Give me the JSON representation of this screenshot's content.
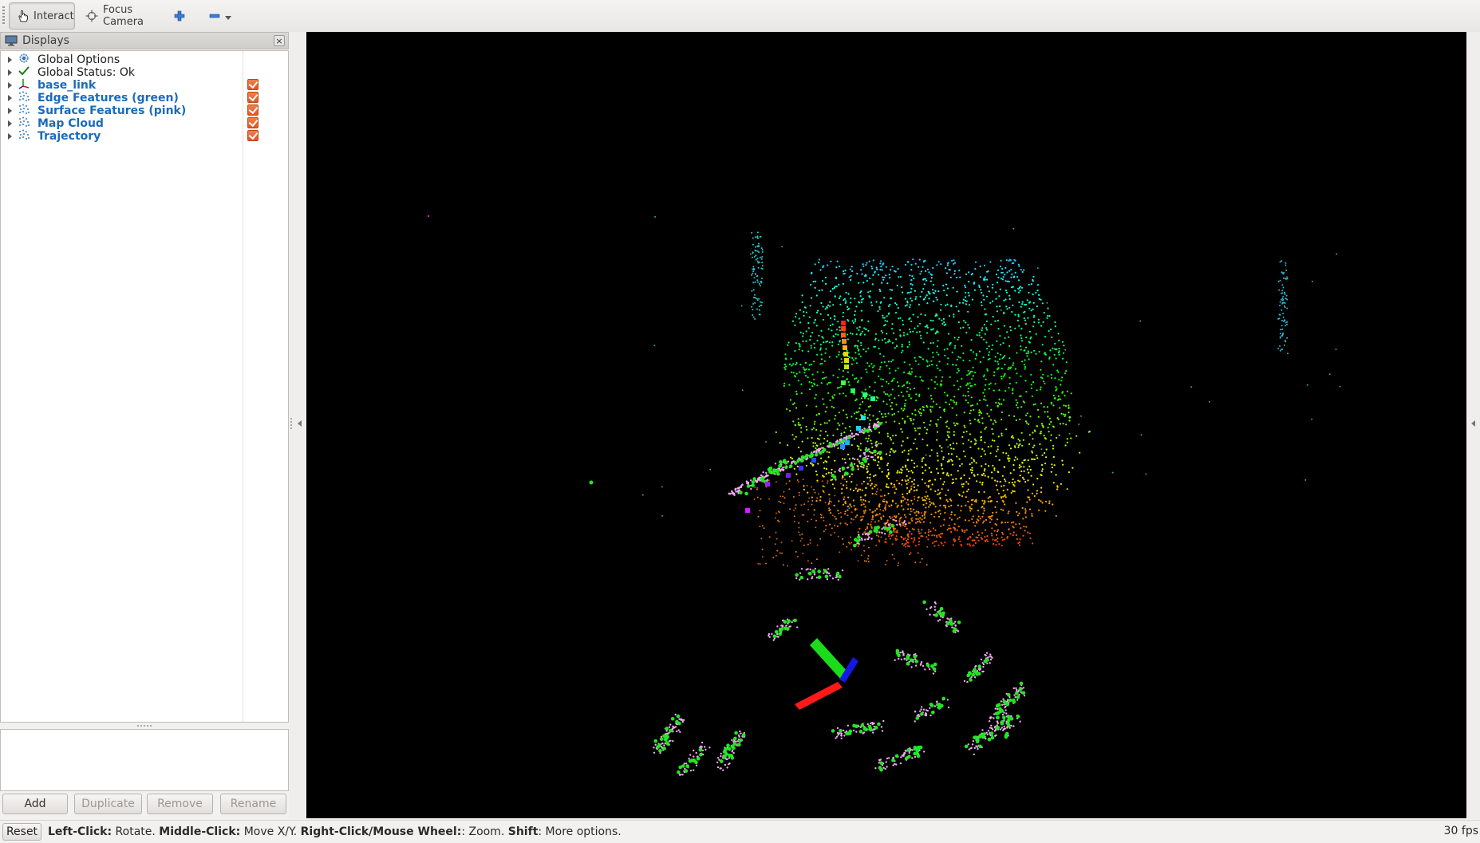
{
  "toolbar": {
    "interact_label": "Interact",
    "focus_camera_label": "Focus Camera",
    "zoom_in_icon": "plus-icon",
    "zoom_out_icon": "minus-icon"
  },
  "displays_panel": {
    "title": "Displays",
    "items": [
      {
        "label": "Global Options",
        "icon": "gear-icon",
        "style": "dark",
        "checked": null
      },
      {
        "label": "Global Status: Ok",
        "icon": "checkmark-icon",
        "style": "dark",
        "checked": null
      },
      {
        "label": "base_link",
        "icon": "axes-icon",
        "style": "blue",
        "checked": true
      },
      {
        "label": "Edge Features (green)",
        "icon": "pointcloud-icon",
        "style": "blue",
        "checked": true
      },
      {
        "label": "Surface Features (pink)",
        "icon": "pointcloud-icon",
        "style": "blue",
        "checked": true
      },
      {
        "label": "Map Cloud",
        "icon": "pointcloud-icon",
        "style": "blue",
        "checked": true
      },
      {
        "label": "Trajectory",
        "icon": "pointcloud-icon",
        "style": "blue",
        "checked": true
      }
    ],
    "buttons": {
      "add": "Add",
      "duplicate": "Duplicate",
      "remove": "Remove",
      "rename": "Rename"
    }
  },
  "colors": {
    "edge_features": "#22e622",
    "surface_features": "#f0a8f0",
    "checkbox": "#e8652c",
    "link_blue": "#1c6bb8",
    "background_3d": "#000000"
  },
  "status_bar": {
    "reset_label": "Reset",
    "help": [
      {
        "key": "Left-Click:",
        "action": " Rotate. "
      },
      {
        "key": "Middle-Click:",
        "action": " Move X/Y. "
      },
      {
        "key": "Right-Click/Mouse Wheel:",
        "action": ": Zoom. "
      },
      {
        "key": "Shift",
        "action": ": More options."
      }
    ],
    "fps": "30 fps"
  }
}
